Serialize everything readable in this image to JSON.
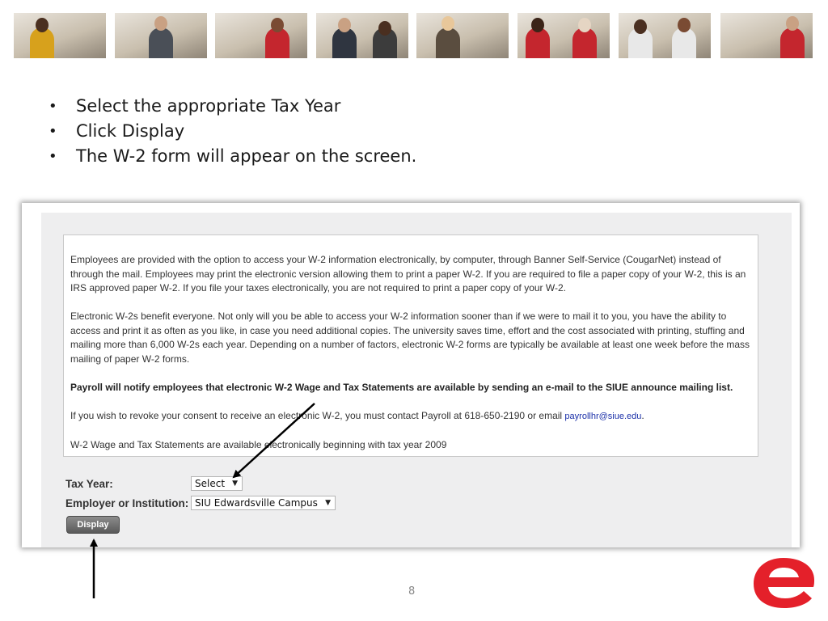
{
  "photos": [
    {
      "name": "photo-student-lab",
      "accent": "#d7a11c"
    },
    {
      "name": "photo-student-newspaper",
      "accent": "#4a4f57"
    },
    {
      "name": "photo-dental-class",
      "accent": "#c4262e"
    },
    {
      "name": "photo-business-men",
      "accent": "#2f3540"
    },
    {
      "name": "photo-meeting",
      "accent": "#5a4d3f"
    },
    {
      "name": "photo-nursing-students",
      "accent": "#c4262e"
    },
    {
      "name": "photo-lab-researchers",
      "accent": "#e8e8e8"
    },
    {
      "name": "photo-medical-training",
      "accent": "#c4262e"
    }
  ],
  "bullets": [
    "Select the appropriate Tax Year",
    "Click Display",
    "The W-2 form will appear on the screen."
  ],
  "info": {
    "p1": "Employees are provided with the option to access your W-2 information electronically, by computer, through Banner Self-Service (CougarNet) instead of through the mail. Employees may print the electronic version allowing them to print a paper W-2. If you are required to file a paper copy of your W-2, this is an IRS approved paper W-2. If you file your taxes electronically, you are not required to print a paper copy of your W-2.",
    "p2": "Electronic W-2s benefit everyone. Not only will you be able to access your W-2 information sooner than if we were to mail it to you, you have the ability to access and print it as often as you like, in case you need additional copies. The university saves time, effort and the cost associated with printing, stuffing and mailing more than 6,000 W-2s each year. Depending on a number of factors, electronic W-2 forms are typically be available at least one week before the mass mailing of paper W-2 forms.",
    "p3": "Payroll will notify employees that electronic W-2 Wage and Tax Statements are available by sending an e-mail to the SIUE announce mailing list.",
    "p4_prefix": "If you wish to revoke your consent to receive an electronic W-2, you must contact Payroll at 618-650-2190 or email ",
    "p4_email": "payrollhr@siue.edu",
    "p4_suffix": ".",
    "p5": "W-2 Wage and Tax Statements are available electronically beginning with tax year 2009"
  },
  "form": {
    "tax_year_label": "Tax Year:",
    "tax_year_value": "Select",
    "employer_label": "Employer or Institution:",
    "employer_value": "SIU Edwardsville Campus",
    "display_button": "Display"
  },
  "page_number": "8",
  "logo": {
    "letter": "e",
    "color": "#e4202a"
  },
  "colors": {
    "accent": "#e4202a",
    "link": "#1a2fa8"
  }
}
